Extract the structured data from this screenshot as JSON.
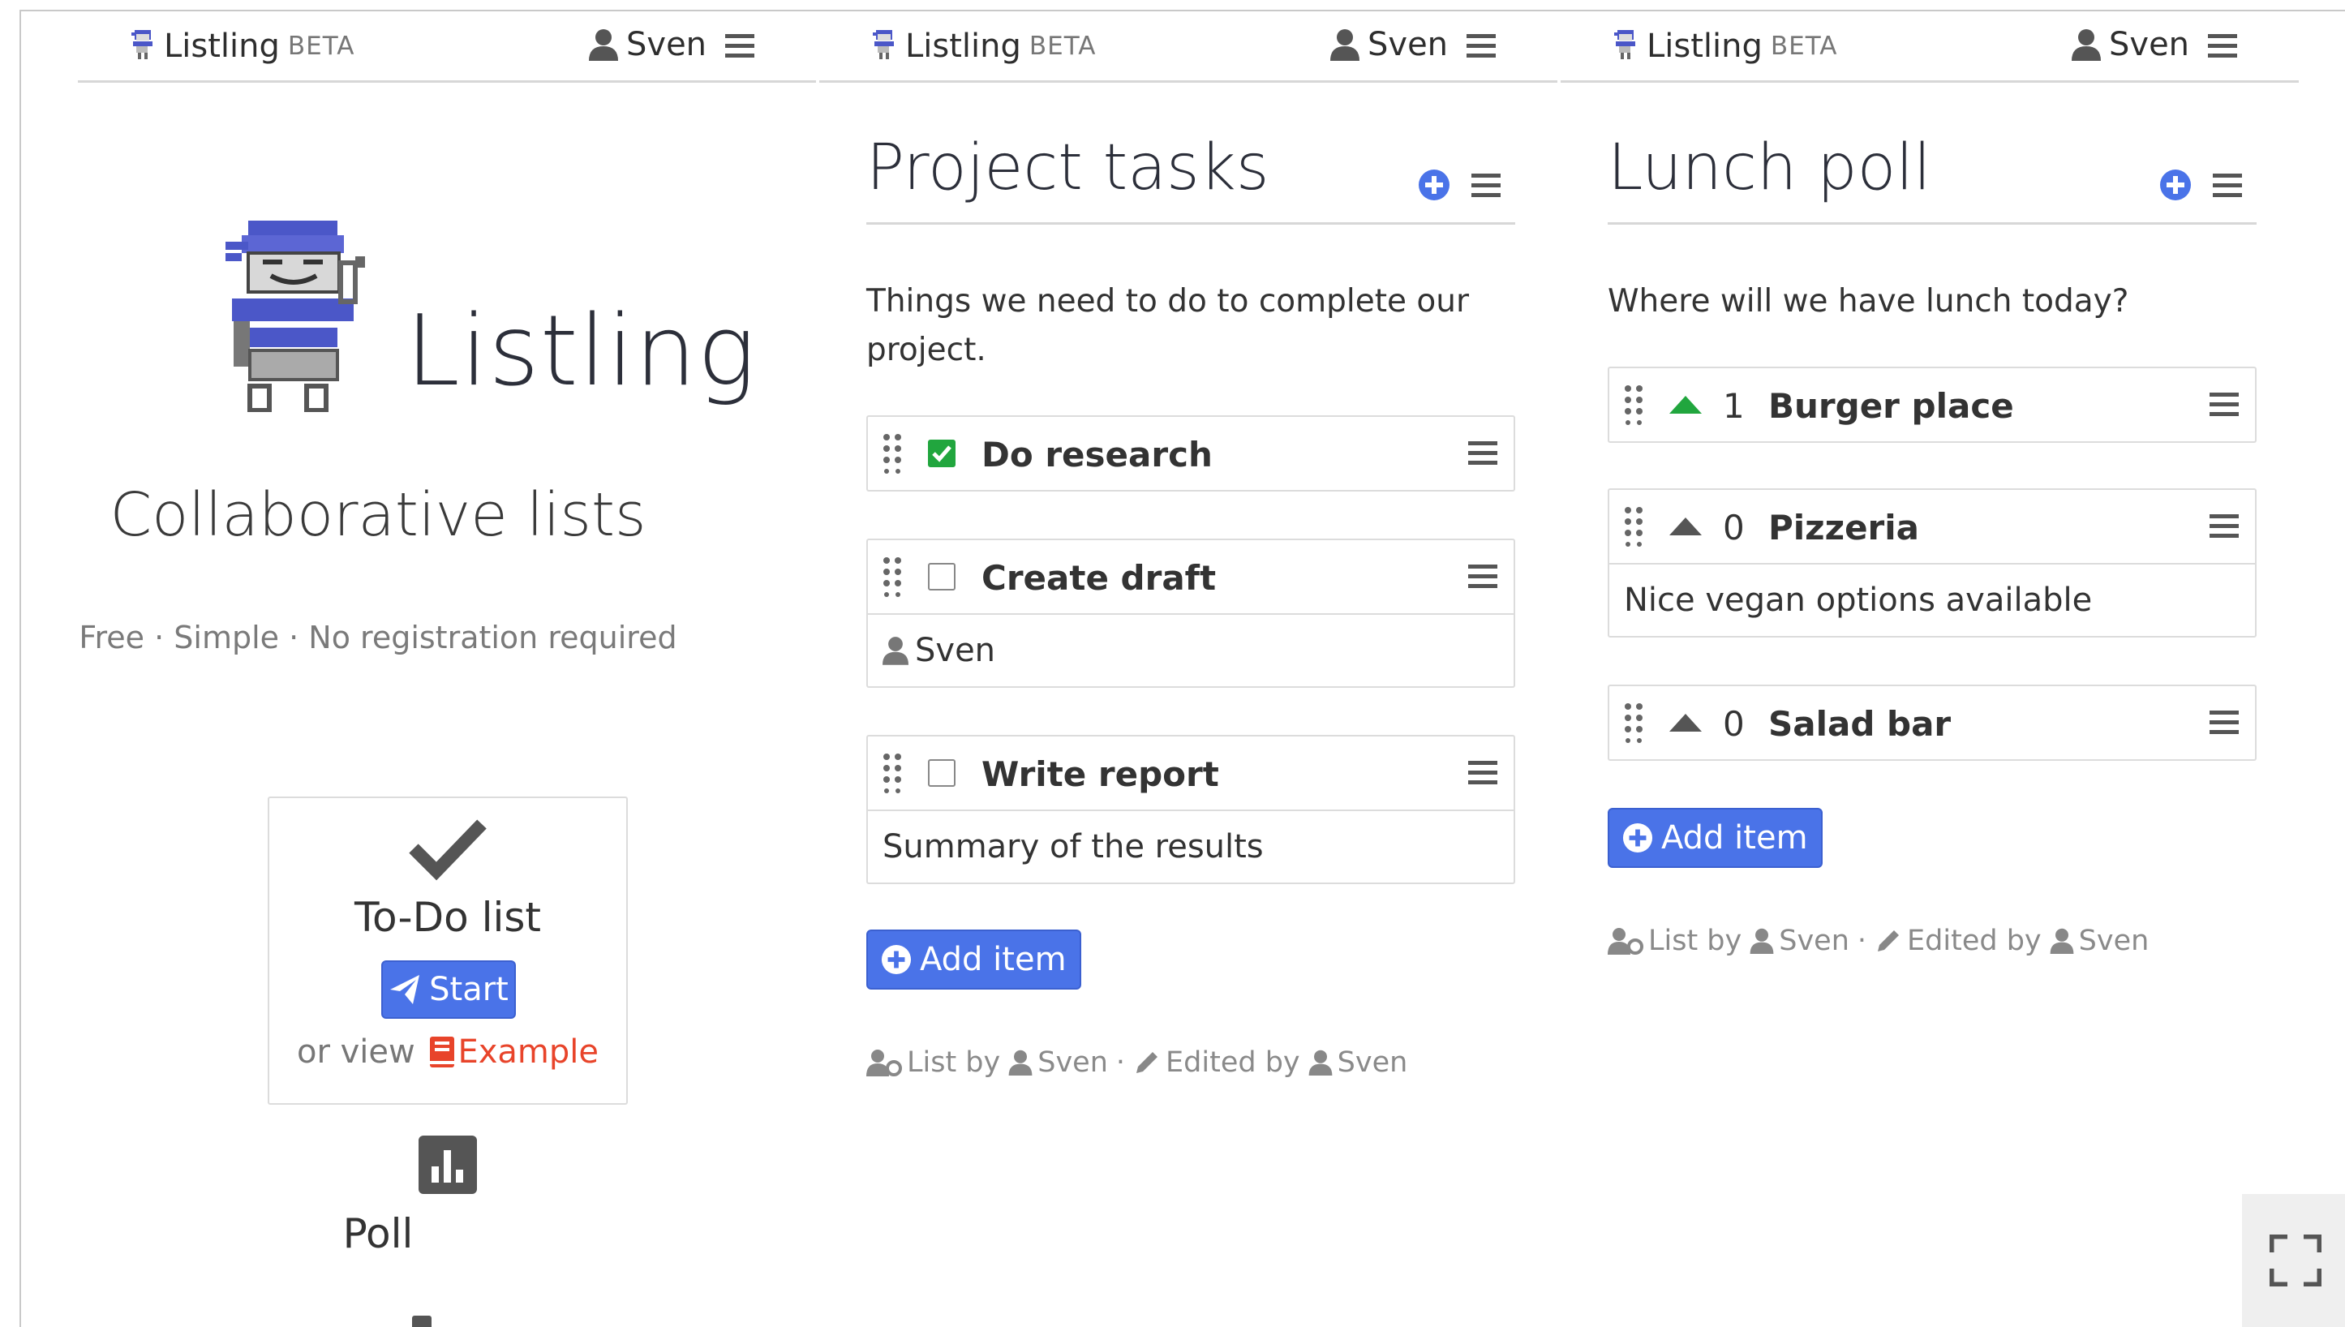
{
  "panels": [
    {
      "header": {
        "brand": "Listling",
        "beta": "BETA",
        "user": "Sven"
      },
      "logo_text": "Listling",
      "tagline": "Collaborative lists",
      "subline": "Free · Simple · No registration required",
      "todo_card": {
        "title": "To-Do list",
        "start_label": "Start",
        "or_view": "or view",
        "example_label": "Example"
      },
      "poll": {
        "label": "Poll"
      }
    },
    {
      "header": {
        "brand": "Listling",
        "beta": "BETA",
        "user": "Sven"
      },
      "title": "Project tasks",
      "description": "Things we need to do to complete our project.",
      "items": [
        {
          "text": "Do research",
          "checked": true
        },
        {
          "text": "Create draft",
          "checked": false,
          "assignee": "Sven"
        },
        {
          "text": "Write report",
          "checked": false,
          "note": "Summary of the results"
        }
      ],
      "add_label": "Add item",
      "meta": {
        "list_by": "List by",
        "owner": "Sven",
        "edited_by": "Edited by",
        "editor": "Sven"
      }
    },
    {
      "header": {
        "brand": "Listling",
        "beta": "BETA",
        "user": "Sven"
      },
      "title": "Lunch poll",
      "description": "Where will we have lunch today?",
      "items": [
        {
          "votes": "1",
          "text": "Burger place",
          "voted": true
        },
        {
          "votes": "0",
          "text": "Pizzeria",
          "voted": false,
          "note": "Nice vegan options available"
        },
        {
          "votes": "0",
          "text": "Salad bar",
          "voted": false
        }
      ],
      "add_label": "Add item",
      "meta": {
        "list_by": "List by",
        "owner": "Sven",
        "edited_by": "Edited by",
        "editor": "Sven"
      }
    }
  ],
  "colors": {
    "accent": "#4a73e8",
    "check": "#21a63e",
    "example": "#e8442a",
    "robot": "#4b57c8"
  },
  "icons": [
    "listling-logo-icon",
    "user-icon",
    "menu-icon",
    "plus-circle-icon",
    "drag-handle-icon",
    "checkbox-icon",
    "vote-up-icon",
    "paper-plane-icon",
    "book-icon",
    "check-icon",
    "bar-chart-icon",
    "pencil-icon",
    "users-cog-icon",
    "fullscreen-icon"
  ]
}
